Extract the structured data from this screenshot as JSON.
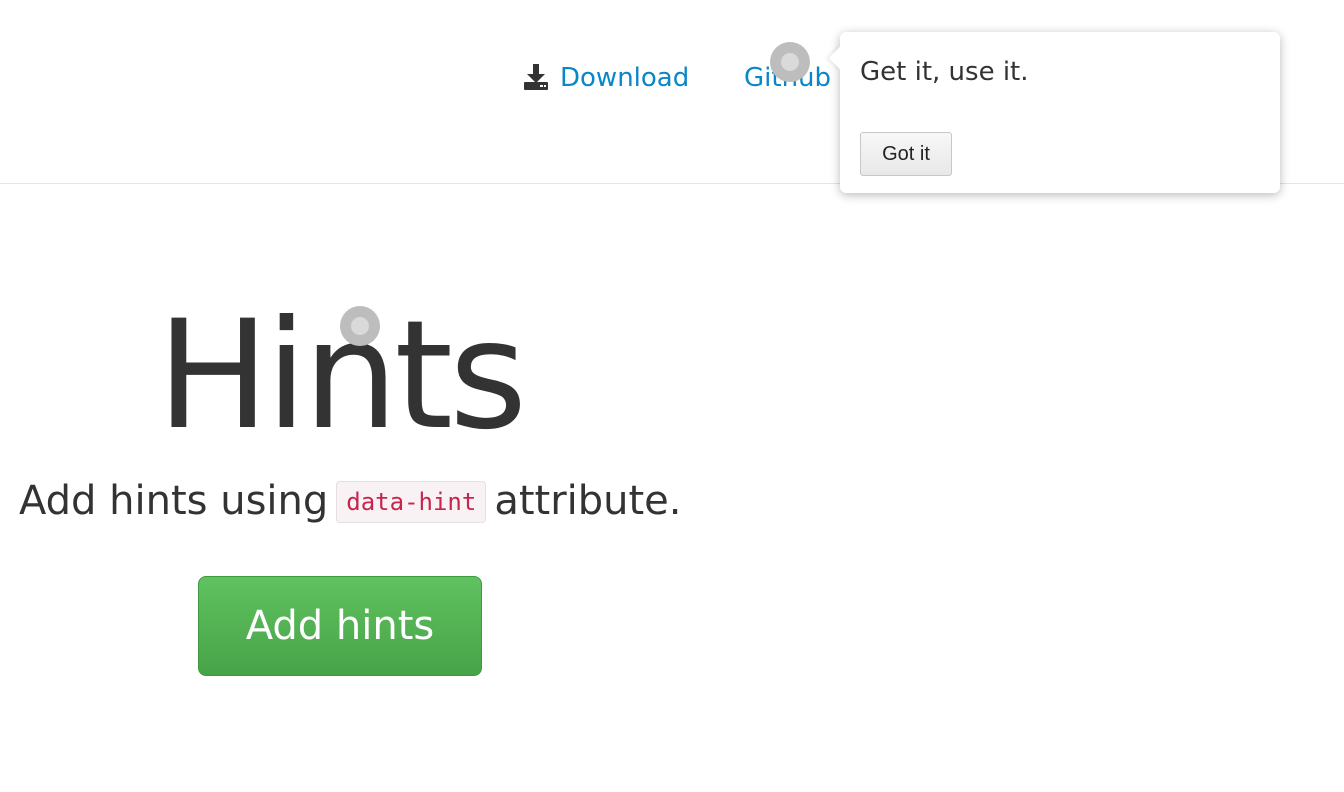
{
  "nav": {
    "download_icon": "download-icon",
    "download_label": "Download",
    "github_label": "Github",
    "link_color": "#0a87c8"
  },
  "popover": {
    "text": "Get it, use it.",
    "button_label": "Got it"
  },
  "hero": {
    "title": "Hints",
    "subtitle_before": "Add hints using",
    "code": "data-hint",
    "subtitle_after": "attribute.",
    "button_label": "Add hints",
    "button_color": "#5cb85c"
  },
  "colors": {
    "text": "#333333",
    "code_text": "#c7254e",
    "beacon": "#bdbdbd"
  }
}
